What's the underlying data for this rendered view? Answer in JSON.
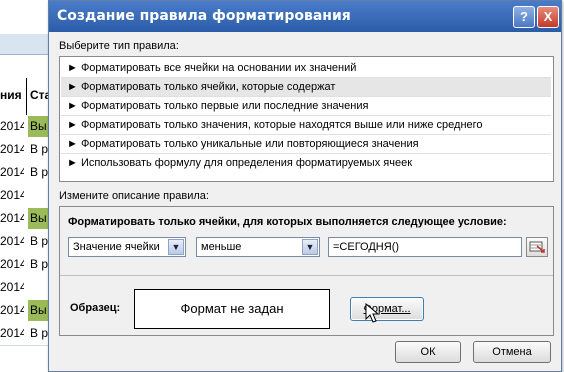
{
  "spreadsheet": {
    "header_text": "ния",
    "status_header": "Ста",
    "rows": [
      {
        "date": "2014",
        "status": "Вы",
        "highlight": true
      },
      {
        "date": "2014",
        "status": "В р",
        "highlight": false
      },
      {
        "date": "2014",
        "status": "В р",
        "highlight": false
      },
      {
        "date": "2014",
        "status": "",
        "highlight": false
      },
      {
        "date": "2014",
        "status": "Вы",
        "highlight": true
      },
      {
        "date": "2014",
        "status": "В р",
        "highlight": false
      },
      {
        "date": "2014",
        "status": "В р",
        "highlight": false
      },
      {
        "date": "2014",
        "status": "",
        "highlight": false
      },
      {
        "date": "2014",
        "status": "Вы",
        "highlight": true
      },
      {
        "date": "2014",
        "status": "В р",
        "highlight": false
      }
    ],
    "highlight_color": "#9bbb59"
  },
  "dialog": {
    "title": "Создание правила форматирования",
    "help_icon": "?",
    "close_icon": "X",
    "rule_type_label": "Выберите тип правила:",
    "rule_types": [
      "► Форматировать все ячейки на основании их значений",
      "► Форматировать только ячейки, которые содержат",
      "► Форматировать только первые или последние значения",
      "► Форматировать только значения, которые находятся выше или ниже среднего",
      "► Форматировать только уникальные или повторяющиеся значения",
      "► Использовать формулу для определения форматируемых ячеек"
    ],
    "selected_rule_index": 1,
    "description_label": "Измените описание правила:",
    "condition_title": "Форматировать только ячейки, для которых выполняется следующее условие:",
    "condition_type": "Значение ячейки",
    "operator": "меньше",
    "value": "=СЕГОДНЯ()",
    "sample_label": "Образец:",
    "preview_text": "Формат не задан",
    "format_button": "Формат...",
    "ok_button": "ОК",
    "cancel_button": "Отмена",
    "titlebar_color": "#2a5ca8"
  }
}
